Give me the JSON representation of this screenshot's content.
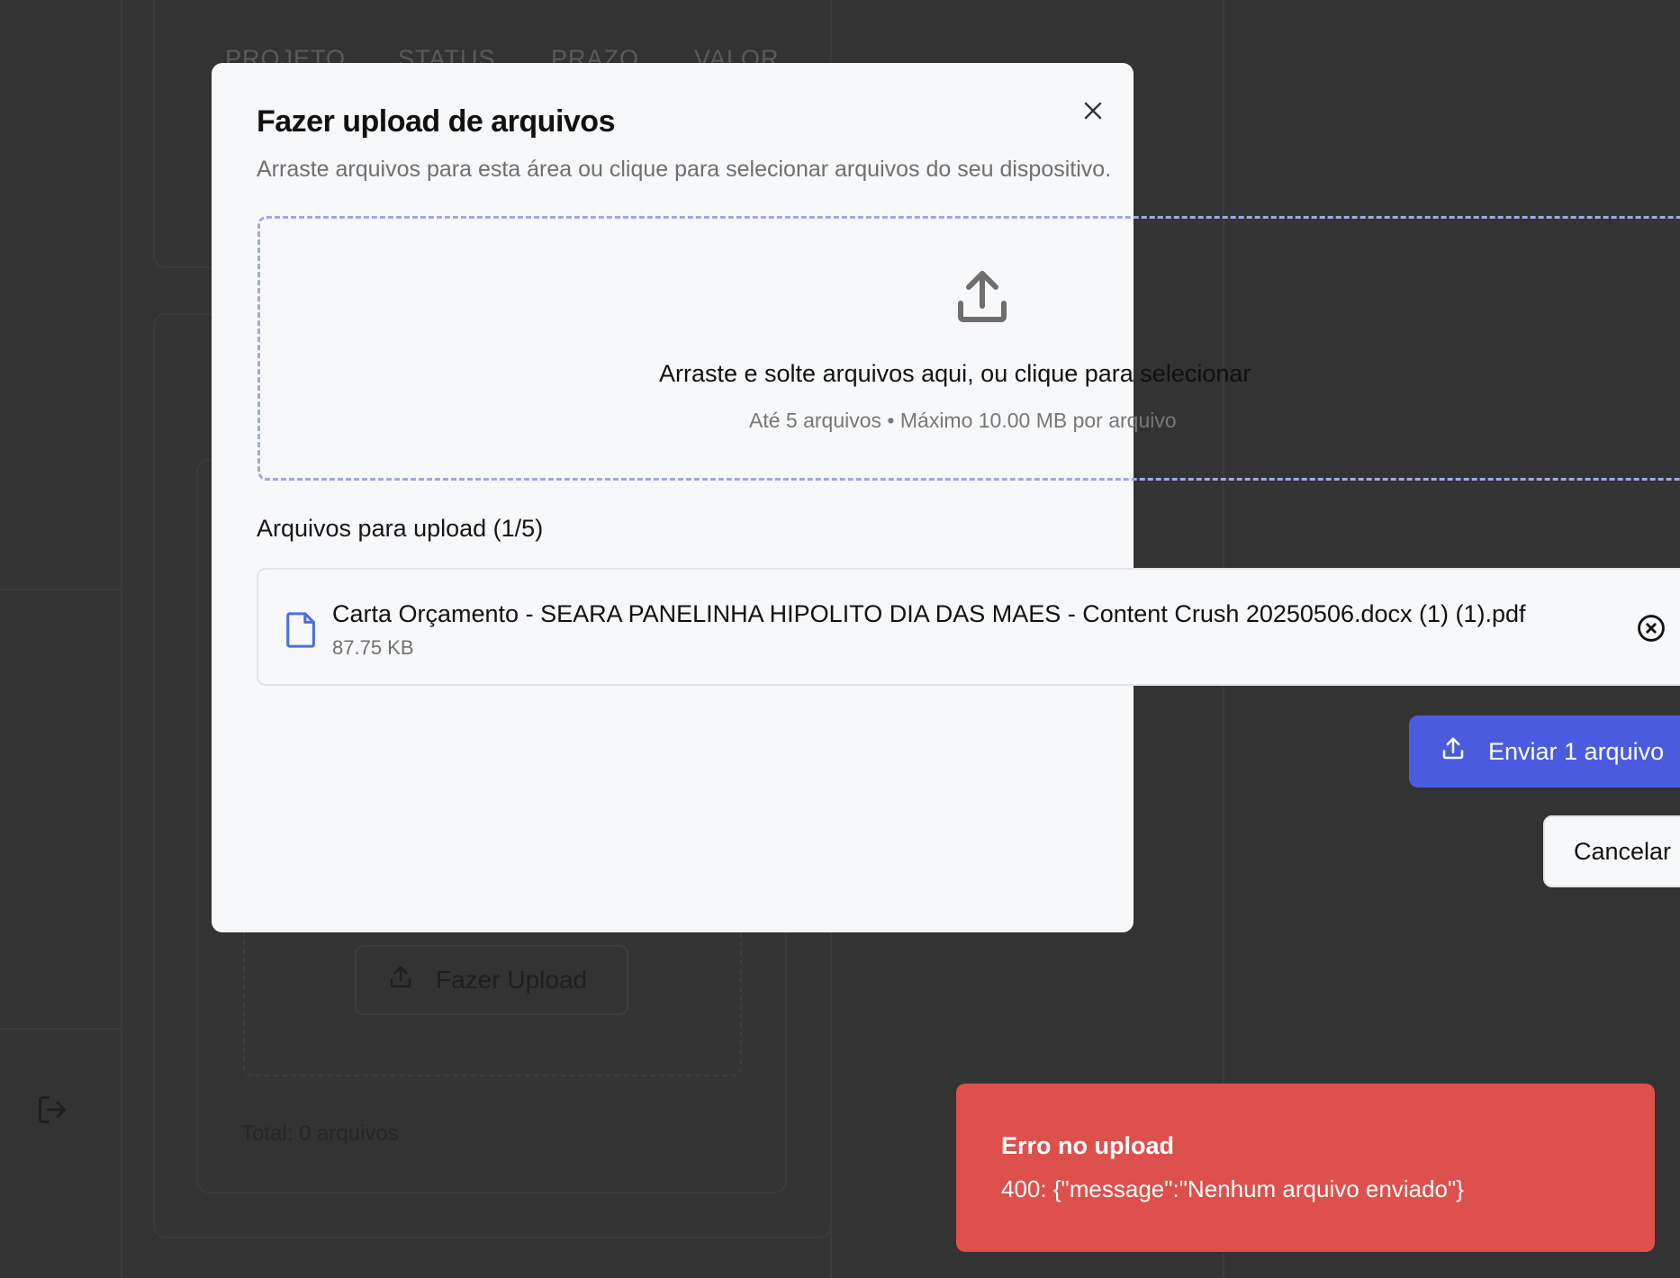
{
  "background": {
    "table_headers": [
      "PROJETO",
      "STATUS",
      "PRAZO",
      "VALOR"
    ],
    "upload_button_label": "Fazer Upload",
    "total_label": "Total: 0 arquivos"
  },
  "modal": {
    "title": "Fazer upload de arquivos",
    "subtitle": "Arraste arquivos para esta área ou clique para selecionar arquivos do seu dispositivo.",
    "dropzone": {
      "main_text": "Arraste e solte arquivos aqui, ou clique para selecionar",
      "hint_text": "Até 5 arquivos • Máximo 10.00 MB por arquivo"
    },
    "files_heading": "Arquivos para upload (1/5)",
    "files": [
      {
        "name": "Carta Orçamento - SEARA PANELINHA HIPOLITO DIA DAS MAES - Content Crush 20250506.docx (1) (1).pdf",
        "size": "87.75 KB"
      }
    ],
    "send_button": "Enviar 1 arquivo",
    "cancel_button": "Cancelar"
  },
  "toast": {
    "title": "Erro no upload",
    "message": "400: {\"message\":\"Nenhum arquivo enviado\"}"
  },
  "colors": {
    "accent": "#4b5be0",
    "error": "#de504c",
    "overlay": "#333333",
    "modal_bg": "#f7f8fa"
  }
}
